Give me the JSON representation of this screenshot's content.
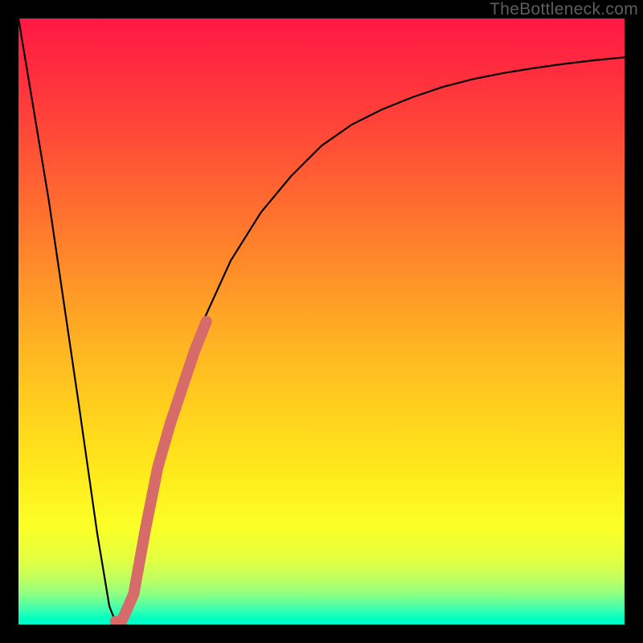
{
  "watermark": "TheBottleneck.com",
  "chart_data": {
    "type": "line",
    "title": "",
    "xlabel": "",
    "ylabel": "",
    "xlim": [
      0,
      100
    ],
    "ylim": [
      0,
      100
    ],
    "series": [
      {
        "name": "bottleneck-curve",
        "x": [
          0,
          5,
          10,
          13,
          15,
          16,
          17,
          18,
          20,
          25,
          30,
          35,
          40,
          45,
          50,
          55,
          60,
          65,
          70,
          75,
          80,
          85,
          90,
          95,
          100
        ],
        "values": [
          100,
          70,
          36,
          15,
          3,
          0.5,
          0.5,
          2,
          10,
          33,
          49,
          60,
          68,
          74,
          79,
          82.5,
          85,
          87,
          88.7,
          90,
          91,
          91.8,
          92.5,
          93.1,
          93.6
        ]
      },
      {
        "name": "highlight-segment",
        "x": [
          16,
          17,
          19,
          21,
          23,
          25,
          27,
          29,
          31
        ],
        "values": [
          0.5,
          0.5,
          5,
          16,
          26,
          33,
          39,
          45,
          50
        ]
      }
    ],
    "colors": {
      "curve": "#000000",
      "highlight": "#d76b69",
      "gradient_top": "#ff1845",
      "gradient_bottom": "#00ffc9"
    }
  }
}
